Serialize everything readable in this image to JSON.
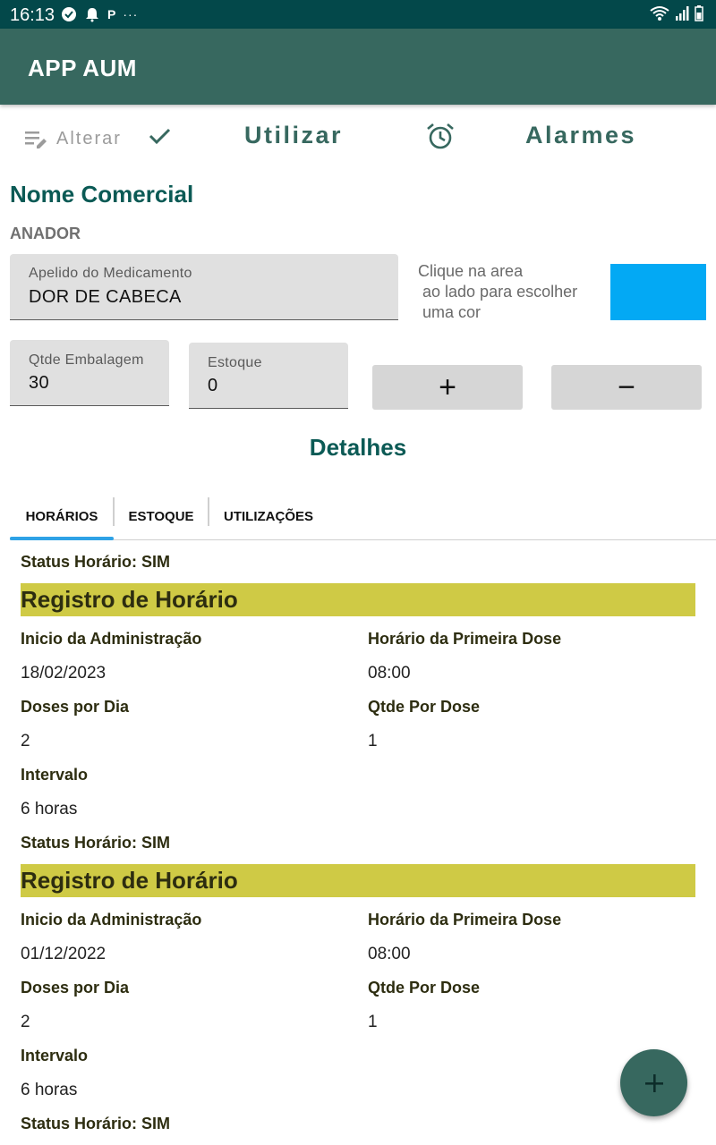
{
  "status_bar": {
    "time": "16:13",
    "icons_left": [
      "check-circle-icon",
      "alarm-bell-icon",
      "p-icon",
      "more-dots-icon"
    ],
    "icons_right": [
      "wifi-icon",
      "signal-icon",
      "battery-icon"
    ]
  },
  "app": {
    "title": "APP AUM"
  },
  "toolbar": {
    "edit_label": "Alterar",
    "use_label": "Utilizar",
    "alarms_label": "Alarmes"
  },
  "section": {
    "title": "Nome Comercial",
    "product": "ANADOR"
  },
  "fields": {
    "nickname": {
      "label": "Apelido do Medicamento",
      "value": "DOR DE CABECA"
    },
    "package_qty": {
      "label": "Qtde Embalagem",
      "value": "30"
    },
    "stock": {
      "label": "Estoque",
      "value": "0"
    }
  },
  "color_picker": {
    "hint": "Clique na area\n ao lado para escolher\n uma cor",
    "color": "#03a9f4"
  },
  "buttons": {
    "plus": "+",
    "minus": "−"
  },
  "details": {
    "title": "Detalhes",
    "tabs": [
      "HORÁRIOS",
      "ESTOQUE",
      "UTILIZAÇÕES"
    ],
    "active_tab": 0
  },
  "labels": {
    "status": "Status Horário: SIM",
    "record_title": "Registro de Horário",
    "start": "Inicio da Administração",
    "first_dose": "Horário da Primeira Dose",
    "doses_per_day": "Doses por Dia",
    "qty_per_dose": "Qtde Por Dose",
    "interval": "Intervalo"
  },
  "records": [
    {
      "start": "18/02/2023",
      "first_dose": "08:00",
      "doses_per_day": "2",
      "qty_per_dose": "1",
      "interval": "6 horas"
    },
    {
      "start": "01/12/2022",
      "first_dose": "08:00",
      "doses_per_day": "2",
      "qty_per_dose": "1",
      "interval": "6 horas"
    }
  ],
  "colors": {
    "app_bar": "#37685f",
    "status_bar": "#03484a",
    "record_bar": "#cfca45",
    "accent_tab": "#2ea2e6"
  }
}
